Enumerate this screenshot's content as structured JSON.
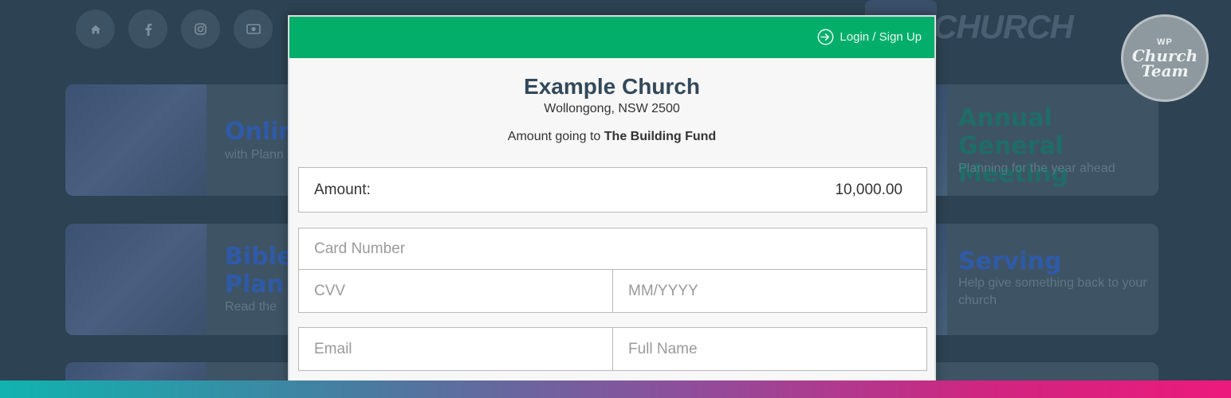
{
  "background": {
    "social_icons": [
      "home-icon",
      "facebook-icon",
      "instagram-icon",
      "money-icon"
    ],
    "logo_text": "CHURCH",
    "left_cards": [
      {
        "title": "Onlin",
        "sub": "with Plann"
      },
      {
        "title": "Bible\nPlan",
        "sub": "Read the"
      }
    ],
    "right_cards": [
      {
        "title": "Annual General Meeting",
        "sub": "Planning for the year ahead"
      },
      {
        "title": "Serving",
        "sub": "Help give something back to your church"
      }
    ],
    "badge": {
      "top": "WP",
      "line1": "Church",
      "line2": "Team"
    }
  },
  "modal": {
    "header_color": "#03ae6a",
    "login_label": "Login / Sign Up",
    "church_name": "Example Church",
    "location": "Wollongong, NSW 2500",
    "fund_prefix": "Amount going to",
    "fund_name": "The Building Fund",
    "amount_label": "Amount:",
    "amount_value": "10,000.00",
    "card_number_placeholder": "Card Number",
    "cvv_placeholder": "CVV",
    "expiry_placeholder": "MM/YYYY",
    "email_placeholder": "Email",
    "fullname_placeholder": "Full Name"
  }
}
